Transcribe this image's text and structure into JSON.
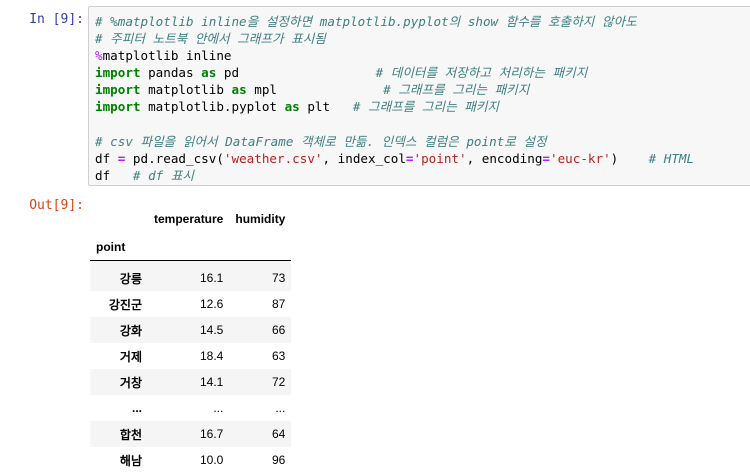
{
  "cell_in": {
    "prompt": "In [9]:",
    "lines": [
      [
        {
          "t": "cm",
          "v": "# %matplotlib inline을 설정하면 matplotlib.pyplot의 show 함수를 호출하지 않아도"
        }
      ],
      [
        {
          "t": "cm",
          "v": "# 주피터 노트북 안에서 그래프가 표시됨"
        }
      ],
      [
        {
          "t": "mg",
          "v": "%"
        },
        {
          "t": "nm",
          "v": "matplotlib inline"
        }
      ],
      [
        {
          "t": "kw",
          "v": "import"
        },
        {
          "t": "nm",
          "v": " pandas "
        },
        {
          "t": "kw",
          "v": "as"
        },
        {
          "t": "nm",
          "v": " pd                  "
        },
        {
          "t": "cm",
          "v": "# 데이터를 저장하고 처리하는 패키지"
        }
      ],
      [
        {
          "t": "kw",
          "v": "import"
        },
        {
          "t": "nm",
          "v": " matplotlib "
        },
        {
          "t": "kw",
          "v": "as"
        },
        {
          "t": "nm",
          "v": " mpl              "
        },
        {
          "t": "cm",
          "v": "# 그래프를 그리는 패키지"
        }
      ],
      [
        {
          "t": "kw",
          "v": "import"
        },
        {
          "t": "nm",
          "v": " matplotlib.pyplot "
        },
        {
          "t": "kw",
          "v": "as"
        },
        {
          "t": "nm",
          "v": " plt   "
        },
        {
          "t": "cm",
          "v": "# 그래프를 그리는 패키지"
        }
      ],
      [],
      [
        {
          "t": "cm",
          "v": "# csv 파일을 읽어서 DataFrame 객체로 만듦. 인덱스 컬럼은 point로 설정"
        }
      ],
      [
        {
          "t": "nm",
          "v": "df "
        },
        {
          "t": "op",
          "v": "="
        },
        {
          "t": "nm",
          "v": " pd.read_csv("
        },
        {
          "t": "st",
          "v": "'weather.csv'"
        },
        {
          "t": "nm",
          "v": ", index_col"
        },
        {
          "t": "op",
          "v": "="
        },
        {
          "t": "st",
          "v": "'point'"
        },
        {
          "t": "nm",
          "v": ", encoding"
        },
        {
          "t": "op",
          "v": "="
        },
        {
          "t": "st",
          "v": "'euc-kr'"
        },
        {
          "t": "nm",
          "v": ")    "
        },
        {
          "t": "cm",
          "v": "# HTML"
        }
      ],
      [
        {
          "t": "nm",
          "v": "df   "
        },
        {
          "t": "cm",
          "v": "# df 표시"
        }
      ]
    ]
  },
  "cell_out": {
    "prompt": "Out[9]:",
    "dataframe": {
      "columns": [
        "temperature",
        "humidity"
      ],
      "index_name": "point",
      "rows": [
        {
          "index": "강릉",
          "temperature": "16.1",
          "humidity": "73"
        },
        {
          "index": "강진군",
          "temperature": "12.6",
          "humidity": "87"
        },
        {
          "index": "강화",
          "temperature": "14.5",
          "humidity": "66"
        },
        {
          "index": "거제",
          "temperature": "18.4",
          "humidity": "63"
        },
        {
          "index": "거창",
          "temperature": "14.1",
          "humidity": "72"
        },
        {
          "index": "...",
          "temperature": "...",
          "humidity": "..."
        },
        {
          "index": "합천",
          "temperature": "16.7",
          "humidity": "64"
        },
        {
          "index": "해남",
          "temperature": "10.0",
          "humidity": "96"
        }
      ]
    }
  }
}
